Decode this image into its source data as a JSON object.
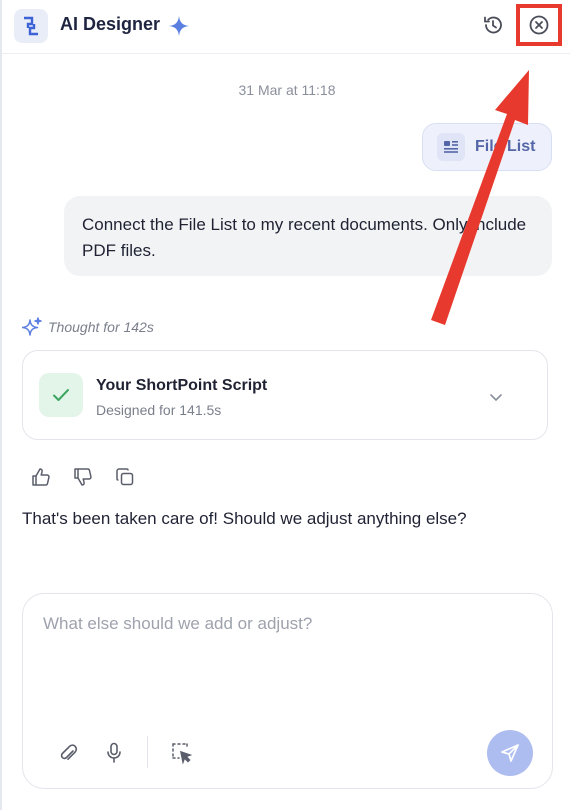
{
  "header": {
    "title": "AI Designer",
    "icons": {
      "logo": "shortpoint-logo-icon",
      "sparkle": "sparkle-icon",
      "history": "history-icon",
      "close": "close-circle-icon"
    }
  },
  "conversation": {
    "timestamp": "31 Mar at 11:18",
    "attachment_chip": {
      "label": "File List",
      "icon": "file-list-icon"
    },
    "user_message": "Connect the File List to my recent documents. Only include PDF files.",
    "thought_label": "Thought for 142s",
    "script_card": {
      "title": "Your ShortPoint Script",
      "subtitle": "Designed for 141.5s",
      "status_icon": "check-icon"
    },
    "feedback_icons": [
      "thumbs-up-icon",
      "thumbs-down-icon",
      "copy-icon"
    ],
    "assistant_reply": "That's been taken care of! Should we adjust anything else?"
  },
  "composer": {
    "placeholder": "What else should we add or adjust?",
    "value": "",
    "tools": [
      "paperclip-icon",
      "microphone-icon",
      "select-element-icon"
    ],
    "send_icon": "send-icon"
  },
  "annotation": {
    "highlight_color": "#e8392e"
  },
  "colors": {
    "accent": "#5566a8",
    "send_button": "#aebdf0",
    "success": "#3ca661"
  }
}
